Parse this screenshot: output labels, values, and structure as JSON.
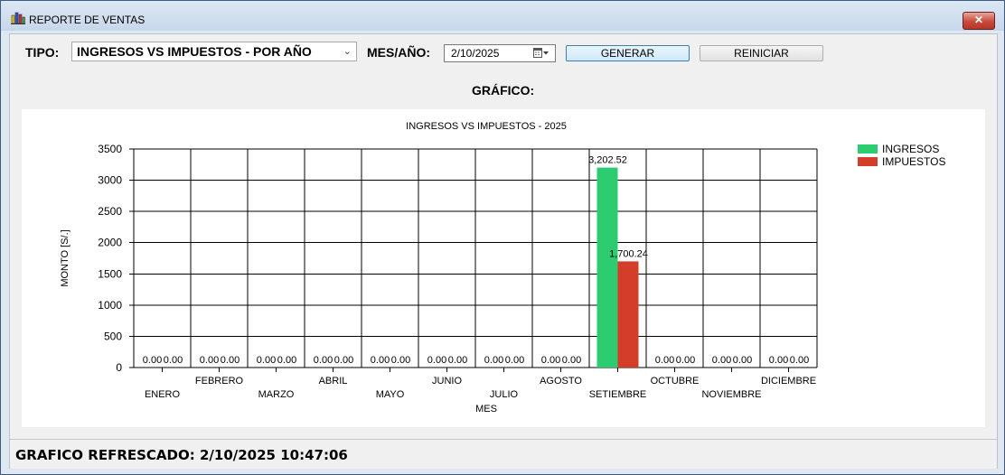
{
  "window": {
    "title": "REPORTE DE VENTAS",
    "close_label": "✕"
  },
  "toolbar": {
    "tipo_label": "TIPO:",
    "tipo_value": "INGRESOS VS IMPUESTOS - POR AÑO",
    "mes_label": "MES/AÑO:",
    "date_value": "2/10/2025",
    "generate_label": "GENERAR",
    "reset_label": "REINICIAR"
  },
  "grafico_label": "GRÁFICO:",
  "status": {
    "text": "GRAFICO REFRESCADO: 2/10/2025 10:47:06"
  },
  "colors": {
    "ingresos": "#2ecc71",
    "impuestos": "#d43d2a"
  },
  "chart_data": {
    "type": "bar",
    "title": "INGRESOS VS IMPUESTOS - 2025",
    "xlabel": "MES",
    "ylabel": "MONTO [S/.]",
    "ylim": [
      0,
      3500
    ],
    "yticks": [
      0,
      500,
      1000,
      1500,
      2000,
      2500,
      3000,
      3500
    ],
    "categories": [
      "ENERO",
      "FEBRERO",
      "MARZO",
      "ABRIL",
      "MAYO",
      "JUNIO",
      "JULIO",
      "AGOSTO",
      "SETIEMBRE",
      "OCTUBRE",
      "NOVIEMBRE",
      "DICIEMBRE"
    ],
    "series": [
      {
        "name": "INGRESOS",
        "values": [
          0,
          0,
          0,
          0,
          0,
          0,
          0,
          0,
          3202.52,
          0,
          0,
          0
        ],
        "labels": [
          "0.00",
          "0.00",
          "0.00",
          "0.00",
          "0.00",
          "0.00",
          "0.00",
          "0.00",
          "3,202.52",
          "0.00",
          "0.00",
          "0.00"
        ]
      },
      {
        "name": "IMPUESTOS",
        "values": [
          0,
          0,
          0,
          0,
          0,
          0,
          0,
          0,
          1700.24,
          0,
          0,
          0
        ],
        "labels": [
          "0.00",
          "0.00",
          "0.00",
          "0.00",
          "0.00",
          "0.00",
          "0.00",
          "0.00",
          "1,700.24",
          "0.00",
          "0.00",
          "0.00"
        ]
      }
    ],
    "grid": true,
    "legend": "top-right"
  }
}
